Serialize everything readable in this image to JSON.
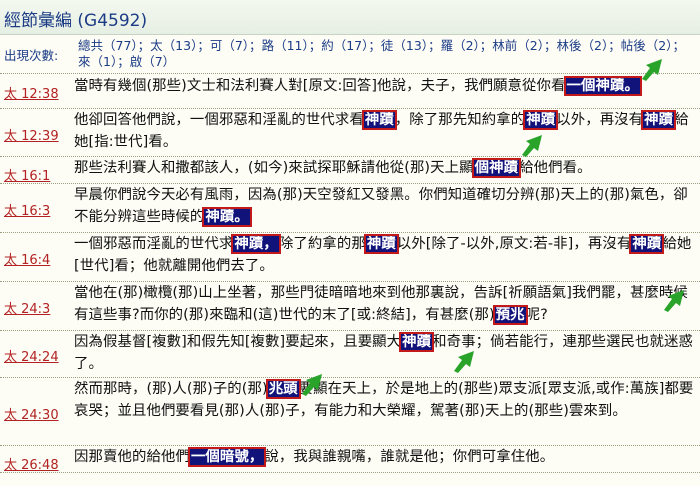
{
  "page": {
    "title": "經節彙編 (G4592)"
  },
  "occurrences": {
    "label": "出現次數:",
    "items": [
      "總共（77）",
      "太（13）",
      "可（7）",
      "路（11）",
      "約（17）",
      "徒（13）",
      "羅（2）",
      "林前（2）",
      "林後（2）",
      "帖後（2）",
      "來（1）",
      "啟（7）"
    ]
  },
  "verses": [
    {
      "ref": "太 12:38",
      "parts": [
        {
          "t": "當時有幾個(那些)文士和法利賽人對[原文:回答]他說，夫子，我們願意從你看"
        },
        {
          "t": "一個神蹟。",
          "hl": true
        }
      ]
    },
    {
      "ref": "太 12:39",
      "parts": [
        {
          "t": "他卻回答他們說，一個邪惡和淫亂的世代求看"
        },
        {
          "t": "神蹟",
          "hl": true
        },
        {
          "t": "，除了那先知約拿的"
        },
        {
          "t": "神蹟",
          "hl": true
        },
        {
          "t": "以外，再沒有"
        },
        {
          "t": "神蹟",
          "hl": true
        },
        {
          "t": "給她[指:世代]看。"
        }
      ]
    },
    {
      "ref": "太 16:1",
      "parts": [
        {
          "t": "那些法利賽人和撒都該人，(如今)來試探耶穌請他從(那)天上顯"
        },
        {
          "t": "個神蹟",
          "hl": true
        },
        {
          "t": "給他們看。"
        }
      ]
    },
    {
      "ref": "太 16:3",
      "parts": [
        {
          "t": "早晨你們說今天必有風雨，因為(那)天空發紅又發黑。你們知道確切分辨(那)天上的(那)氣色，卻不能分辨這些時候的"
        },
        {
          "t": "神蹟。",
          "hl": true
        }
      ]
    },
    {
      "ref": "太 16:4",
      "parts": [
        {
          "t": "一個邪惡而淫亂的世代求"
        },
        {
          "t": "神蹟，",
          "hl": true
        },
        {
          "t": "除了約拿的那"
        },
        {
          "t": "神蹟",
          "hl": true
        },
        {
          "t": "以外[除了-以外,原文:若-非]，再沒有"
        },
        {
          "t": "神蹟",
          "hl": true
        },
        {
          "t": "給她[世代]看；他就離開他們去了。"
        }
      ]
    },
    {
      "ref": "太 24:3",
      "parts": [
        {
          "t": "當他在(那)橄欖(那)山上坐著，那些門徒暗暗地來到他那裏說，告訴[祈願語氣]我們罷，甚麼時候有這些事?而你的(那)來臨和(這)世代的末了[或:終結]，有甚麼(那)"
        },
        {
          "t": "預兆",
          "hl": true
        },
        {
          "t": "呢?"
        }
      ]
    },
    {
      "ref": "太 24:24",
      "parts": [
        {
          "t": "因為假基督[複數]和假先知[複數]要起來，且要顯大"
        },
        {
          "t": "神蹟",
          "hl": true
        },
        {
          "t": "和奇事；倘若能行，連那些選民也就迷惑了。"
        }
      ]
    },
    {
      "ref": "太 24:30",
      "parts": [
        {
          "t": "然而那時，(那)人(那)子的(那)"
        },
        {
          "t": "兆頭",
          "hl": true
        },
        {
          "t": "要顯在天上，於是地上的(那些)眾支派[眾支派,或作:萬族]都要哀哭；並且他們要看見(那)人(那)子，有能力和大榮耀，駕著(那)天上的(那些)雲來到。"
        }
      ]
    },
    {
      "ref": "太 26:48",
      "parts": [
        {
          "t": "因那賣他的給他們"
        },
        {
          "t": "一個暗號，",
          "hl": true
        },
        {
          "t": "說，我與誰親嘴，誰就是他；你們可拿住他。"
        }
      ]
    }
  ],
  "colors": {
    "accent": "#1c3c86",
    "ref": "#b22222",
    "highlight_bg": "#11137a",
    "highlight_border": "#c21a1a",
    "arrow": "#29a329"
  }
}
